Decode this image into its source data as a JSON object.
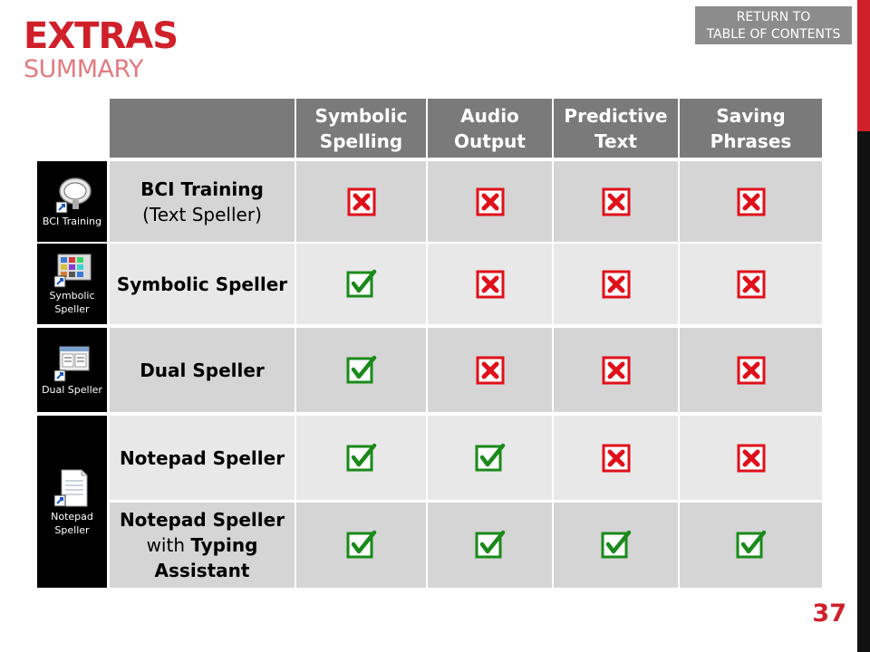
{
  "header": {
    "title": "EXTRAS",
    "subtitle": "SUMMARY",
    "return_line1": "RETURN TO",
    "return_line2": "TABLE OF CONTENTS",
    "page_number": "37"
  },
  "table": {
    "columns": [
      {
        "line1": "Symbolic",
        "line2": "Spelling"
      },
      {
        "line1": "Audio",
        "line2": "Output"
      },
      {
        "line1": "Predictive",
        "line2": "Text"
      },
      {
        "line1": "Saving",
        "line2": "Phrases"
      }
    ],
    "rows": [
      {
        "label_bold": "BCI Training",
        "label_normal": "(Text Speller)",
        "marks": [
          "no",
          "no",
          "no",
          "no"
        ]
      },
      {
        "label_bold": "Symbolic Speller",
        "marks": [
          "yes",
          "no",
          "no",
          "no"
        ]
      },
      {
        "label_bold": "Dual Speller",
        "marks": [
          "yes",
          "no",
          "no",
          "no"
        ]
      },
      {
        "label_bold": "Notepad Speller",
        "marks": [
          "yes",
          "yes",
          "no",
          "no"
        ]
      },
      {
        "label_bold_1": "Notepad Speller",
        "label_normal": "with",
        "label_bold_2": "Typing",
        "label_bold_3": "Assistant",
        "marks": [
          "yes",
          "yes",
          "yes",
          "yes"
        ]
      }
    ]
  },
  "shortcuts": [
    {
      "icon": "bci2000-icon",
      "label": "BCI Training"
    },
    {
      "icon": "symbolic-speller-icon",
      "label_line1": "Symbolic",
      "label_line2": "Speller"
    },
    {
      "icon": "dual-speller-icon",
      "label": "Dual Speller"
    },
    {
      "icon": "notepad-icon",
      "label_line1": "Notepad",
      "label_line2": "Speller"
    }
  ],
  "colors": {
    "accent": "#d0202a",
    "check": "#1a8a1a",
    "cross": "#e0101a",
    "header_bg": "#7a7a7a"
  }
}
